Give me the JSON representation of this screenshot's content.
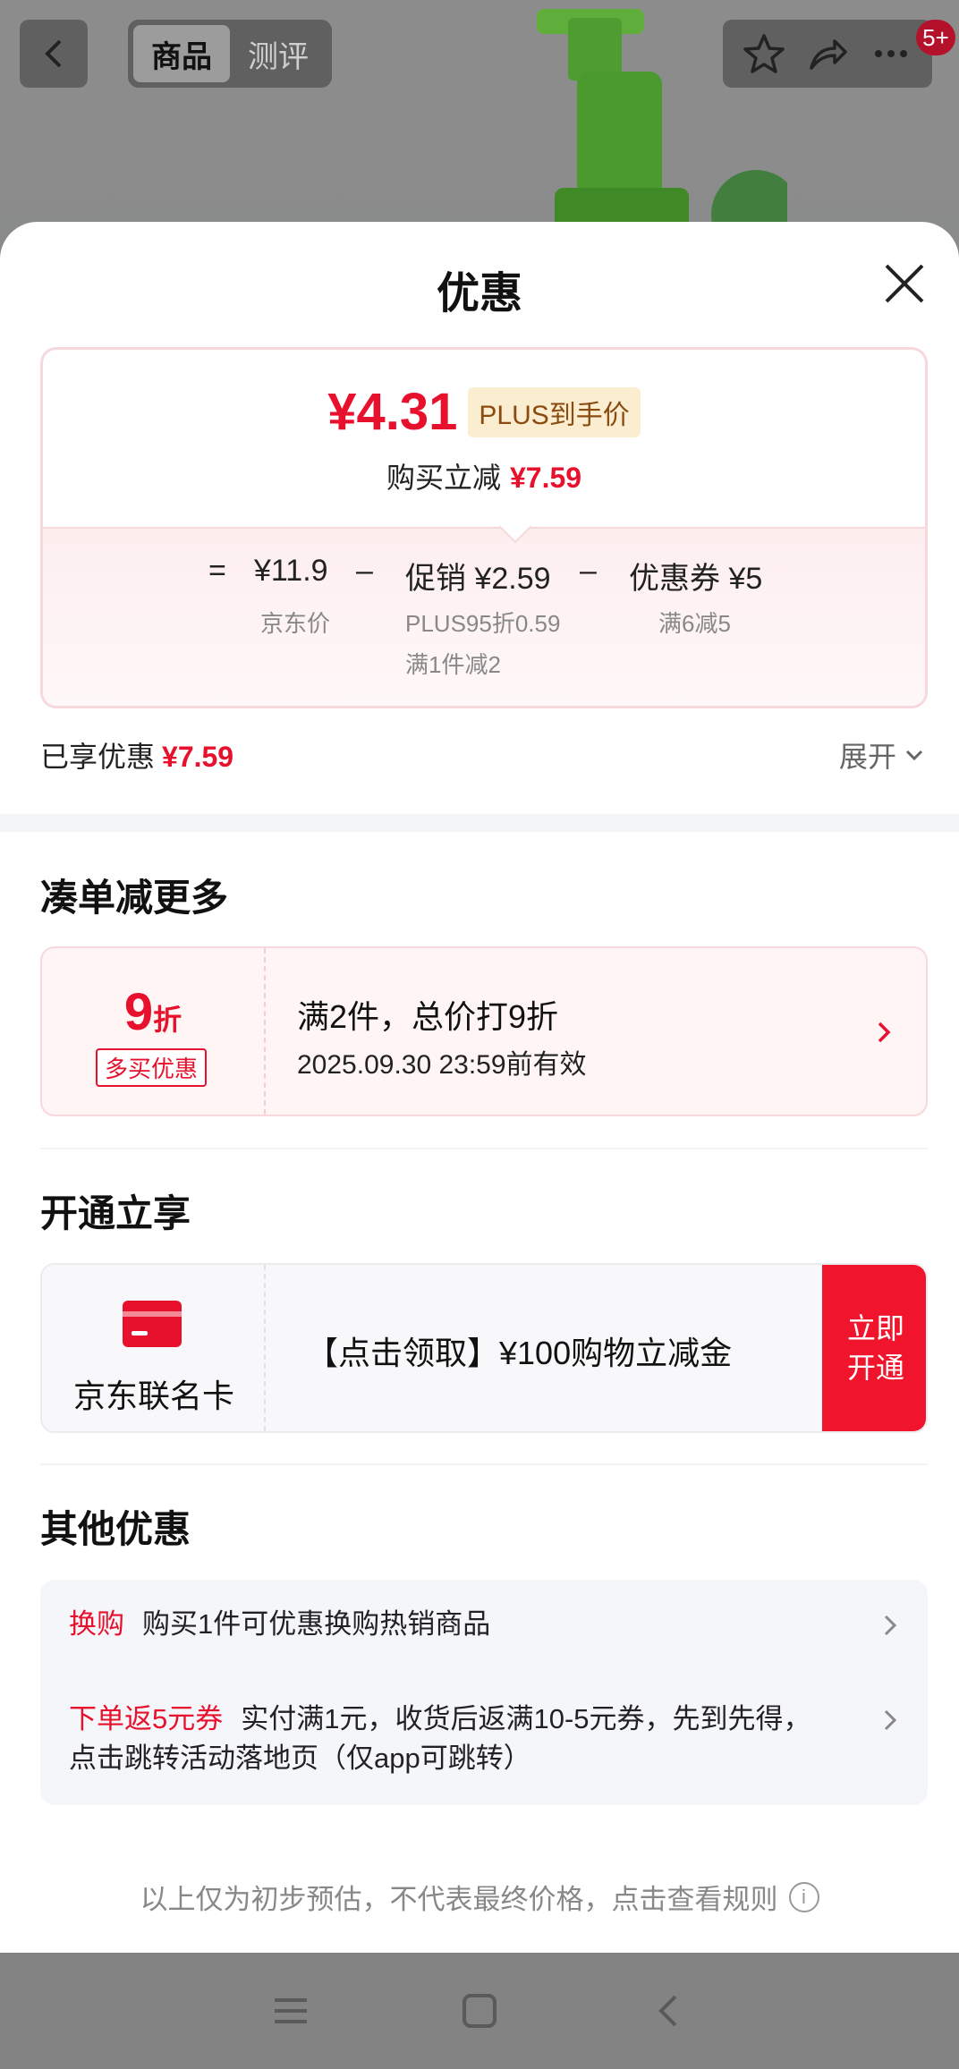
{
  "topbar": {
    "tabs": [
      {
        "label": "商品",
        "active": true
      },
      {
        "label": "测评",
        "active": false
      }
    ],
    "badge": "5+"
  },
  "sheet": {
    "title": "优惠",
    "price": {
      "amount": "¥4.31",
      "plus_tag": "PLUS到手价",
      "save_label": "购买立减",
      "save_value": "¥7.59"
    },
    "formula": {
      "equals": "=",
      "jd_price": "¥11.9",
      "jd_price_label": "京东价",
      "minus": "–",
      "promo": "促销 ¥2.59",
      "promo_detail_1": "PLUS95折0.59",
      "promo_detail_2": "满1件减2",
      "coupon": "优惠券 ¥5",
      "coupon_detail": "满6减5"
    },
    "enjoyed_label": "已享优惠",
    "enjoyed_value": "¥7.59",
    "expand_label": "展开"
  },
  "bundle": {
    "heading": "凑单减更多",
    "discount_num": "9",
    "discount_unit": "折",
    "tag": "多买优惠",
    "line1": "满2件，总价打9折",
    "line2": "2025.09.30 23:59前有效"
  },
  "open": {
    "heading": "开通立享",
    "card_name": "京东联名卡",
    "text": "【点击领取】¥100购物立减金",
    "btn_line1": "立即",
    "btn_line2": "开通"
  },
  "other": {
    "heading": "其他优惠",
    "items": [
      {
        "tag": "换购",
        "text": "购买1件可优惠换购热销商品"
      },
      {
        "tag": "下单返5元券",
        "text": "实付满1元，收货后返满10-5元券，先到先得，",
        "text2": "点击跳转活动落地页（仅app可跳转）"
      }
    ]
  },
  "footnote": "以上仅为初步预估，不代表最终价格，点击查看规则",
  "colors": {
    "accent_red": "#e8112d",
    "button_red": "#f0142d",
    "plus_bg": "#fbedd0"
  }
}
